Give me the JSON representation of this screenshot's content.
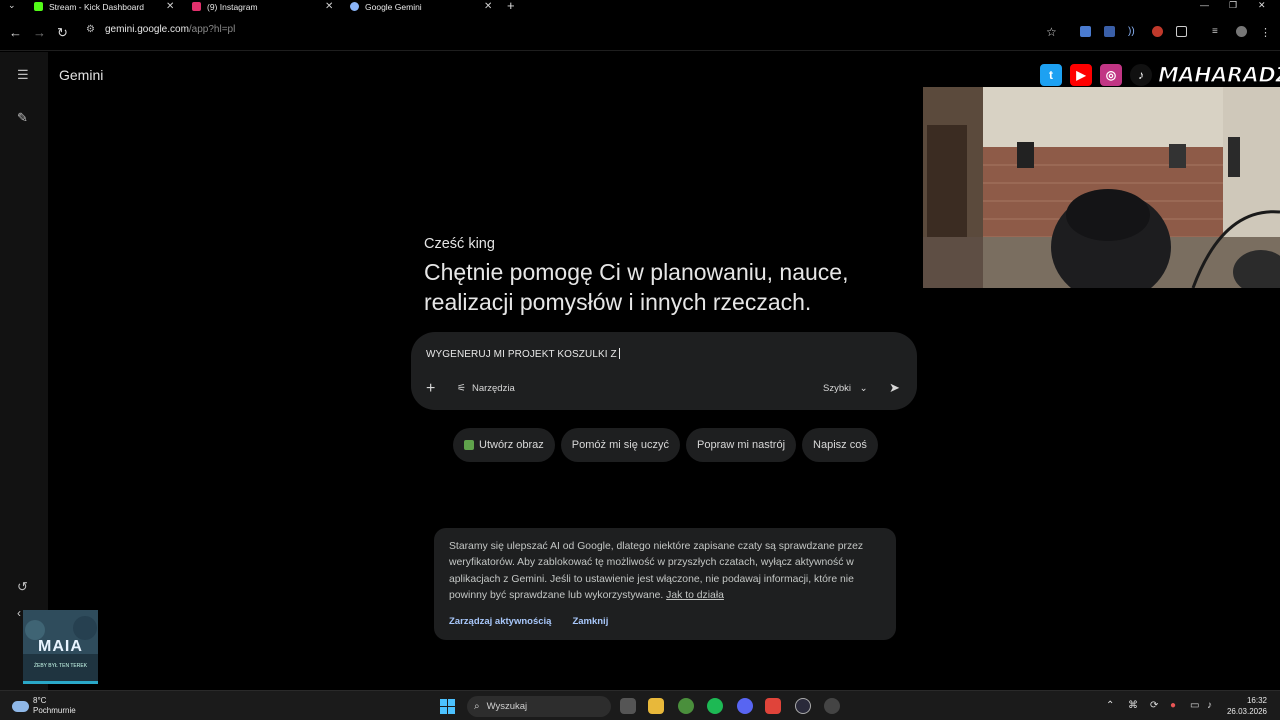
{
  "browser": {
    "tabs": [
      {
        "label": "Stream - Kick Dashboard",
        "favicon_color": "#53fc18"
      },
      {
        "label": "(9) Instagram",
        "favicon_color": "#e1306c"
      },
      {
        "label": "Google Gemini",
        "favicon_color": "#8ab4f8"
      }
    ],
    "url_host": "gemini.google.com",
    "url_path": "/app?hl=pl"
  },
  "app": {
    "title": "Gemini"
  },
  "main": {
    "greeting": "Cześć king",
    "headline": "Chętnie pomogę Ci w planowaniu, nauce, realizacji pomysłów i innych rzeczach."
  },
  "prompt": {
    "value": "WYGENERUJ MI PROJEKT KOSZULKI Z",
    "tools_label": "Narzędzia",
    "mode_label": "Szybki"
  },
  "chips": [
    "Utwórz obraz",
    "Pomóż mi się uczyć",
    "Popraw mi nastrój",
    "Napisz coś"
  ],
  "notice": {
    "text": "Staramy się ulepszać AI od Google, dlatego niektóre zapisane czaty są sprawdzane przez weryfikatorów. Aby zablokować tę możliwość w przyszłych czatach, wyłącz aktywność w aplikacjach z Gemini. Jeśli to ustawienie jest włączone, nie podawaj informacji, które nie powinny być sprawdzane lub wykorzystywane.",
    "link": "Jak to działa",
    "manage_label": "Zarządzaj aktywnością",
    "close_label": "Zamknij"
  },
  "overlay": {
    "brand": "MAHARADZZA",
    "thumb_title": "MAIA",
    "thumb_sub": "ŻEBY BYŁ TEN TEREK"
  },
  "taskbar": {
    "temperature": "8°C",
    "weather": "Pochmurnie",
    "search_label": "Wyszukaj",
    "time": "16:32",
    "date": "26.03.2026"
  },
  "colors": {
    "accent_link": "#a8c7fa",
    "prompt_bg": "#1e1f20",
    "sidebar_bg": "#121212"
  }
}
